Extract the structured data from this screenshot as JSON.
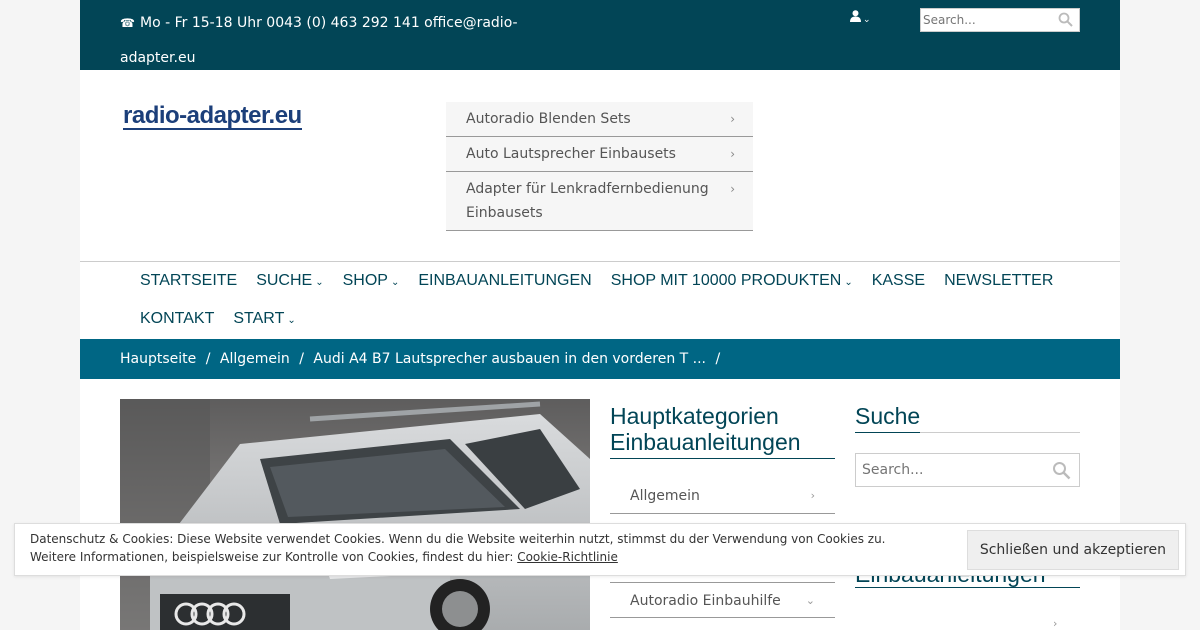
{
  "topbar": {
    "contact_line1": "Mo - Fr 15-18 Uhr 0043 (0) 463 292 141 office@radio-",
    "contact_line2": "adapter.eu",
    "phone_icon": "telephone-icon",
    "user_icon": "user-icon",
    "search_placeholder": "Search..."
  },
  "header": {
    "logo_text": "radio-adapter.eu",
    "categories": [
      {
        "label": "Autoradio Blenden Sets"
      },
      {
        "label": "Auto Lautsprecher Einbausets"
      },
      {
        "label": "Adapter für Lenkradfernbedienung Einbausets"
      }
    ]
  },
  "nav": {
    "row1": [
      {
        "label": "STARTSEITE",
        "dropdown": false
      },
      {
        "label": "SUCHE",
        "dropdown": true
      },
      {
        "label": "SHOP",
        "dropdown": true
      },
      {
        "label": "EINBAUANLEITUNGEN",
        "dropdown": false
      },
      {
        "label": "SHOP MIT 10000 PRODUKTEN",
        "dropdown": true
      },
      {
        "label": "KASSE",
        "dropdown": false
      },
      {
        "label": "NEWSLETTER",
        "dropdown": false
      }
    ],
    "row2": [
      {
        "label": "KONTAKT",
        "dropdown": false
      },
      {
        "label": "START",
        "dropdown": true
      }
    ],
    "chevron": "⌄"
  },
  "breadcrumb": {
    "items": [
      "Hauptseite",
      "Allgemein",
      "Audi A4 B7 Lautsprecher ausbauen in den vorderen T ..."
    ],
    "separator": "/"
  },
  "sidebar_mid": {
    "title": "Hauptkategorien Einbauanleitungen",
    "items": [
      {
        "label": "Allgemein",
        "chev": "›"
      },
      {
        "label": "Autoradio Einbauhilfe",
        "chev": "⌄"
      }
    ]
  },
  "sidebar_right": {
    "title": "Suche",
    "search_placeholder": "Search...",
    "title2": "Einbauanleitungen"
  },
  "cookie": {
    "line1": "Datenschutz & Cookies: Diese Website verwendet Cookies. Wenn du die Website weiterhin nutzt, stimmst du der Verwendung von Cookies zu.",
    "line2": "Weitere Informationen, beispielsweise zur Kontrolle von Cookies, findest du hier: ",
    "link": "Cookie-Richtlinie",
    "button": "Schließen und akzeptieren"
  },
  "colors": {
    "topbar": "#024556",
    "breadcrumb": "#006684",
    "accent": "#024556"
  }
}
